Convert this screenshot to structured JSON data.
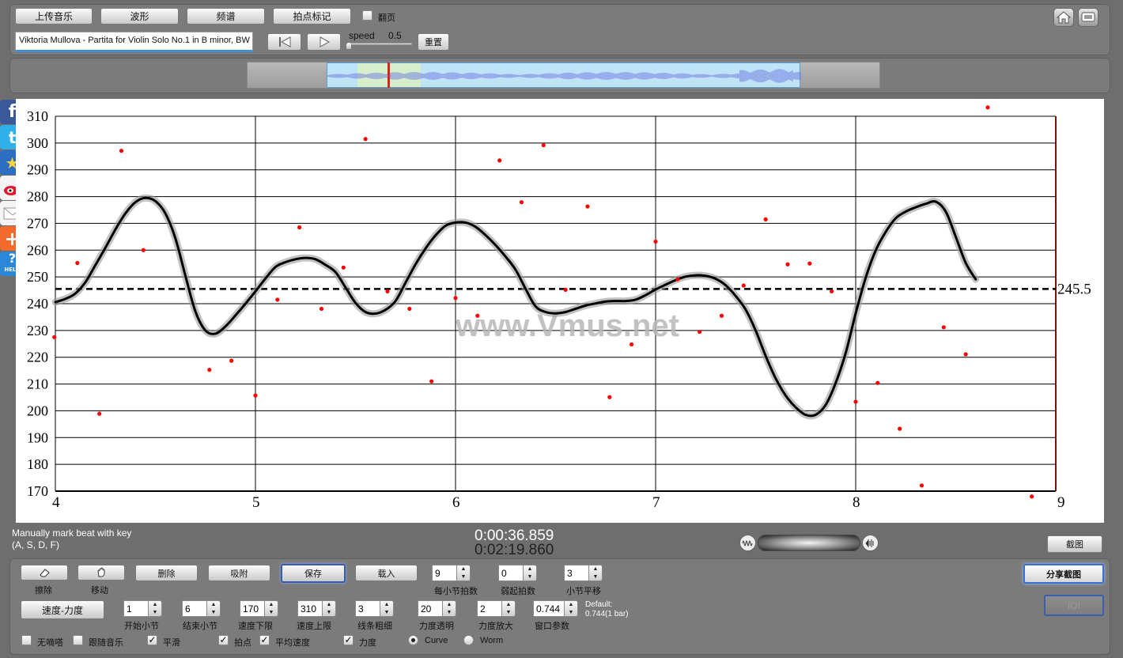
{
  "toolbar": {
    "upload_label": "上传音乐",
    "waveform_label": "波形",
    "spectrum_label": "频谱",
    "beatmark_label": "拍点标记",
    "pageflip_label": "翻页",
    "track_title": "Viktoria Mullova - Partita for Violin Solo No.1 in B minor, BW",
    "speed_label": "speed",
    "speed_value": "0.5",
    "speed_level": 0.0,
    "reset_label": "重置"
  },
  "overview": {
    "window_start_fraction": 0.05,
    "window_end_fraction": 0.15,
    "cursor_fraction": 0.098
  },
  "chart_data": {
    "type": "scatter",
    "x_ticks": [
      "4",
      "5",
      "6",
      "7",
      "8",
      "9"
    ],
    "y_ticks": [
      "310",
      "300",
      "290",
      "280",
      "270",
      "260",
      "250",
      "240",
      "230",
      "220",
      "210",
      "200",
      "190",
      "180",
      "170"
    ],
    "xlim": [
      4,
      9
    ],
    "ylim": [
      170,
      310
    ],
    "grid": true,
    "average_line": 245.5,
    "average_label": "245.5",
    "watermark": "www.Vmus.net",
    "points": [
      [
        3.995,
        227.5
      ],
      [
        4.11,
        255.2
      ],
      [
        4.22,
        198.9
      ],
      [
        4.33,
        297.1
      ],
      [
        4.44,
        260.0
      ],
      [
        4.77,
        215.3
      ],
      [
        4.88,
        218.7
      ],
      [
        5.0,
        205.7
      ],
      [
        5.11,
        241.5
      ],
      [
        5.22,
        268.5
      ],
      [
        5.33,
        238.1
      ],
      [
        5.44,
        253.5
      ],
      [
        5.55,
        301.5
      ],
      [
        5.66,
        244.6
      ],
      [
        5.77,
        238.1
      ],
      [
        5.88,
        211.0
      ],
      [
        6.0,
        242.1
      ],
      [
        6.11,
        235.5
      ],
      [
        6.22,
        293.5
      ],
      [
        6.33,
        277.9
      ],
      [
        6.44,
        299.2
      ],
      [
        6.55,
        245.2
      ],
      [
        6.66,
        276.3
      ],
      [
        6.77,
        205.1
      ],
      [
        6.88,
        224.8
      ],
      [
        7.0,
        263.2
      ],
      [
        7.11,
        249.1
      ],
      [
        7.22,
        229.5
      ],
      [
        7.33,
        235.5
      ],
      [
        7.44,
        246.8
      ],
      [
        7.55,
        271.5
      ],
      [
        7.66,
        254.7
      ],
      [
        7.77,
        255.0
      ],
      [
        7.88,
        244.6
      ],
      [
        8.0,
        203.4
      ],
      [
        8.11,
        210.4
      ],
      [
        8.22,
        193.3
      ],
      [
        8.33,
        172.1
      ],
      [
        8.44,
        231.2
      ],
      [
        8.55,
        221.1
      ],
      [
        8.66,
        313.3
      ],
      [
        8.88,
        168.0
      ]
    ],
    "curve": [
      [
        4.0,
        240.6
      ],
      [
        4.05,
        241.8
      ],
      [
        4.1,
        243.8
      ],
      [
        4.15,
        248.0
      ],
      [
        4.2,
        254.4
      ],
      [
        4.25,
        260.9
      ],
      [
        4.3,
        267.7
      ],
      [
        4.35,
        273.7
      ],
      [
        4.4,
        277.9
      ],
      [
        4.45,
        279.5
      ],
      [
        4.5,
        278.3
      ],
      [
        4.55,
        273.7
      ],
      [
        4.6,
        264.4
      ],
      [
        4.65,
        250.4
      ],
      [
        4.7,
        237.1
      ],
      [
        4.75,
        230.0
      ],
      [
        4.8,
        228.8
      ],
      [
        4.85,
        231.5
      ],
      [
        4.9,
        235.6
      ],
      [
        4.95,
        240.0
      ],
      [
        5.0,
        244.6
      ],
      [
        5.05,
        249.4
      ],
      [
        5.1,
        253.7
      ],
      [
        5.15,
        255.5
      ],
      [
        5.2,
        256.6
      ],
      [
        5.25,
        257.1
      ],
      [
        5.3,
        256.6
      ],
      [
        5.35,
        254.5
      ],
      [
        5.4,
        251.8
      ],
      [
        5.45,
        246.1
      ],
      [
        5.5,
        240.3
      ],
      [
        5.55,
        236.9
      ],
      [
        5.6,
        236.3
      ],
      [
        5.65,
        237.7
      ],
      [
        5.7,
        241.0
      ],
      [
        5.75,
        247.8
      ],
      [
        5.8,
        254.7
      ],
      [
        5.85,
        260.6
      ],
      [
        5.9,
        265.5
      ],
      [
        5.95,
        269.1
      ],
      [
        6.0,
        270.3
      ],
      [
        6.05,
        270.3
      ],
      [
        6.1,
        268.7
      ],
      [
        6.15,
        265.6
      ],
      [
        6.2,
        261.9
      ],
      [
        6.25,
        257.6
      ],
      [
        6.3,
        252.7
      ],
      [
        6.35,
        245.6
      ],
      [
        6.4,
        239.0
      ],
      [
        6.45,
        236.9
      ],
      [
        6.5,
        236.4
      ],
      [
        6.55,
        236.9
      ],
      [
        6.6,
        238.1
      ],
      [
        6.65,
        239.3
      ],
      [
        6.7,
        240.1
      ],
      [
        6.75,
        240.8
      ],
      [
        6.8,
        241.0
      ],
      [
        6.85,
        241.0
      ],
      [
        6.9,
        241.5
      ],
      [
        6.95,
        243.2
      ],
      [
        7.0,
        245.3
      ],
      [
        7.05,
        247.1
      ],
      [
        7.1,
        248.8
      ],
      [
        7.15,
        250.1
      ],
      [
        7.2,
        250.6
      ],
      [
        7.25,
        250.4
      ],
      [
        7.3,
        249.3
      ],
      [
        7.35,
        246.9
      ],
      [
        7.4,
        242.9
      ],
      [
        7.45,
        237.8
      ],
      [
        7.5,
        230.0
      ],
      [
        7.55,
        220.5
      ],
      [
        7.6,
        212.1
      ],
      [
        7.65,
        205.7
      ],
      [
        7.7,
        201.3
      ],
      [
        7.75,
        198.5
      ],
      [
        7.8,
        198.5
      ],
      [
        7.85,
        202.2
      ],
      [
        7.9,
        210.4
      ],
      [
        7.95,
        221.6
      ],
      [
        8.0,
        236.4
      ],
      [
        8.05,
        249.7
      ],
      [
        8.1,
        259.9
      ],
      [
        8.15,
        266.8
      ],
      [
        8.2,
        271.9
      ],
      [
        8.25,
        274.4
      ],
      [
        8.3,
        276.0
      ],
      [
        8.35,
        277.3
      ],
      [
        8.4,
        278.1
      ],
      [
        8.45,
        274.4
      ],
      [
        8.5,
        265.0
      ],
      [
        8.55,
        255.2
      ],
      [
        8.6,
        249.1
      ]
    ]
  },
  "status": {
    "hint_line1": "Manually mark beat with key",
    "hint_line2": "(A, S, D, F)",
    "current_time": "0:00:36.859",
    "total_time": "0:02:19.860",
    "screenshot_label": "截图"
  },
  "controls": {
    "erase_label": "擦除",
    "move_label": "移动",
    "delete_label": "删除",
    "snap_label": "吸附",
    "save_label": "保存",
    "load_label": "载入",
    "beats_per_bar": {
      "value": "9",
      "label": "每小节拍数"
    },
    "pickup_beats": {
      "value": "0",
      "label": "弱起拍数"
    },
    "bar_offset": {
      "value": "3",
      "label": "小节平移"
    },
    "share_label": "分享截图",
    "disabled_label": "IOI",
    "tempo_dynamics_label": "速度-力度",
    "start_bar": {
      "value": "1",
      "label": "开始小节"
    },
    "end_bar": {
      "value": "6",
      "label": "结束小节"
    },
    "tempo_min": {
      "value": "170",
      "label": "速度下限"
    },
    "tempo_max": {
      "value": "310",
      "label": "速度上限"
    },
    "line_width": {
      "value": "3",
      "label": "线条粗细"
    },
    "dynamics_opacity": {
      "value": "20",
      "label": "力度透明"
    },
    "dynamics_zoom": {
      "value": "2",
      "label": "力度放大"
    },
    "window_param": {
      "value": "0.744",
      "label": "窗口参数"
    },
    "default_line1": "Default:",
    "default_line2": "0.744(1 bar)",
    "no_click_label": "无嘀嗒",
    "follow_music_label": "跟随音乐",
    "smooth_label": "平滑",
    "beat_points_label": "拍点",
    "avg_speed_label": "平均速度",
    "dynamics_label": "力度",
    "curve_label": "Curve",
    "worm_label": "Worm"
  },
  "social": [
    "facebook-icon",
    "twitter-icon",
    "star-icon",
    "weibo-icon",
    "mail-icon",
    "add-icon",
    "help-icon"
  ],
  "colors": {
    "background": "#6e6e6e",
    "panel": "#7b7b7b",
    "point": "#ff0000",
    "curve": "#000000",
    "waveform": "#6f7ae0",
    "overview_window": "#bfe3f7",
    "overview_selection": "#d8f0c4"
  }
}
